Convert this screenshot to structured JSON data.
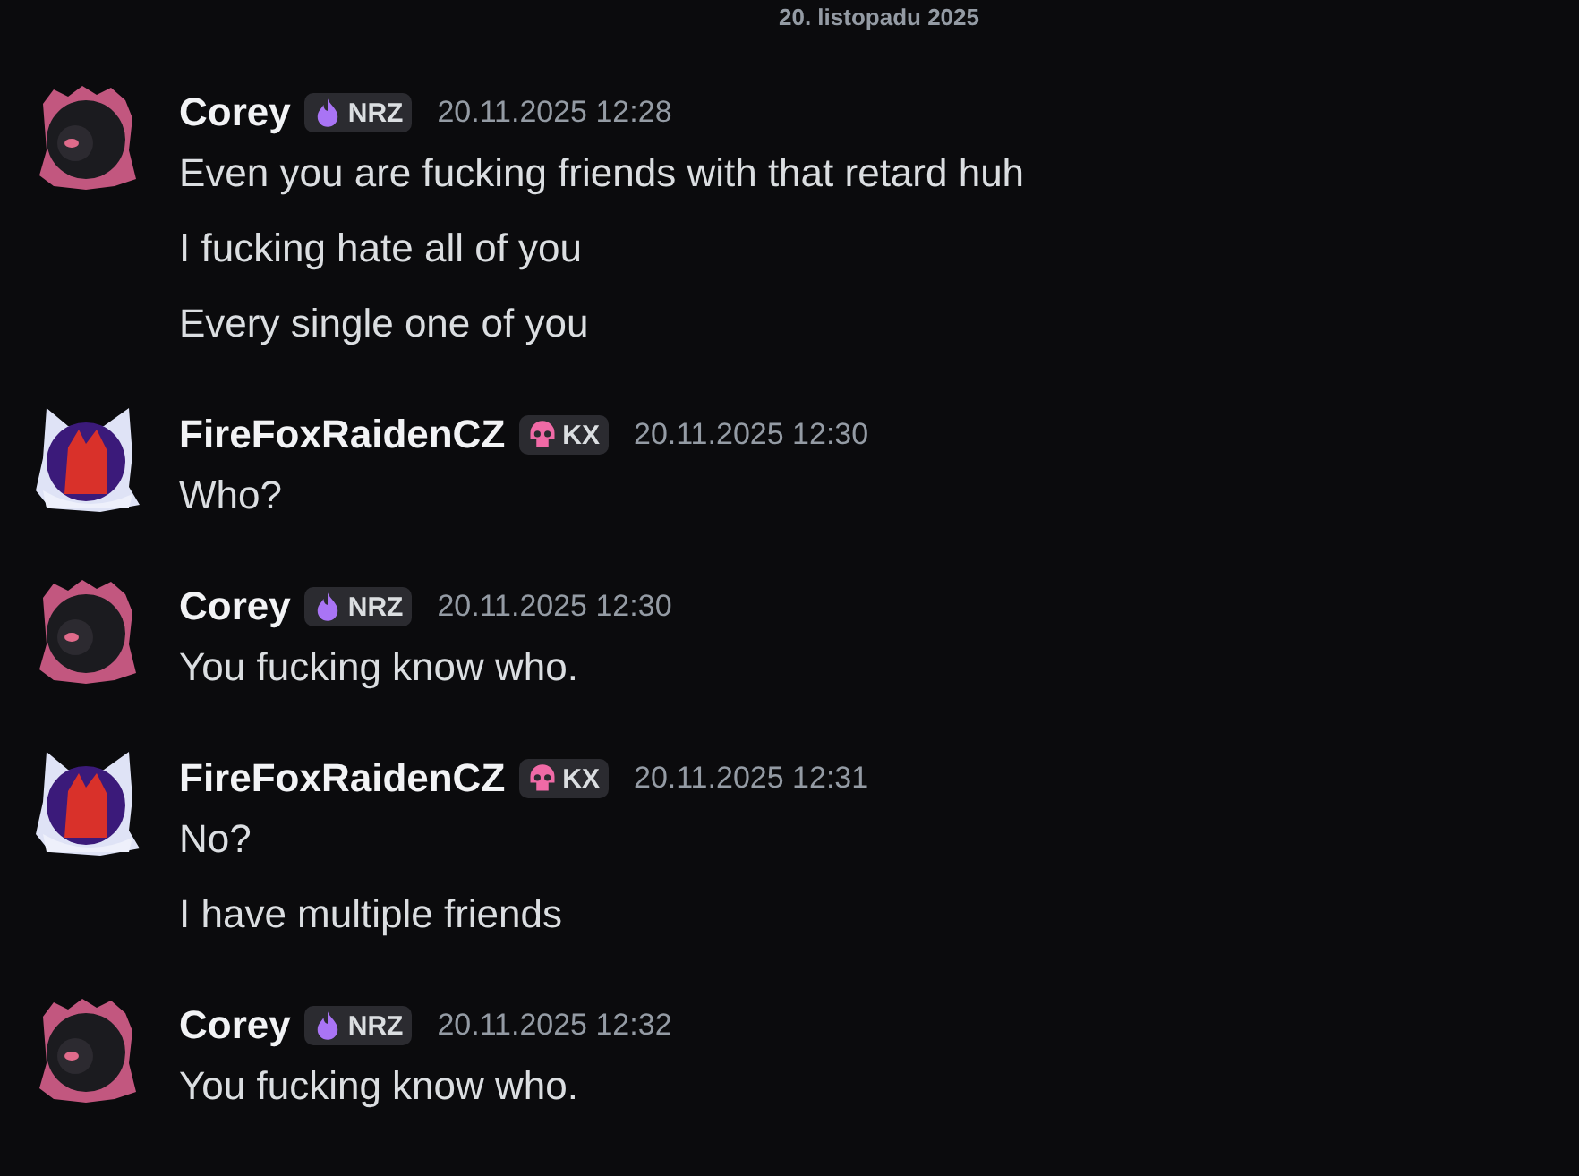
{
  "divider": {
    "label": "20. listopadu 2025"
  },
  "groups": [
    {
      "author": "Corey",
      "kind": "dark",
      "tag": {
        "kind": "flame",
        "text": "NRZ"
      },
      "time": "20.11.2025 12:28",
      "lines": [
        "Even you are fucking friends with that retard huh",
        "I fucking hate all of you",
        "Every single one of you"
      ]
    },
    {
      "author": "FireFoxRaidenCZ",
      "kind": "fox",
      "tag": {
        "kind": "skull",
        "text": "KX"
      },
      "time": "20.11.2025 12:30",
      "lines": [
        "Who?"
      ]
    },
    {
      "author": "Corey",
      "kind": "dark",
      "tag": {
        "kind": "flame",
        "text": "NRZ"
      },
      "time": "20.11.2025 12:30",
      "lines": [
        "You fucking know who."
      ]
    },
    {
      "author": "FireFoxRaidenCZ",
      "kind": "fox",
      "tag": {
        "kind": "skull",
        "text": "KX"
      },
      "time": "20.11.2025 12:31",
      "lines": [
        "No?",
        "I have multiple friends"
      ]
    },
    {
      "author": "Corey",
      "kind": "dark",
      "tag": {
        "kind": "flame",
        "text": "NRZ"
      },
      "time": "20.11.2025 12:32",
      "lines": [
        "You fucking know who."
      ]
    }
  ]
}
